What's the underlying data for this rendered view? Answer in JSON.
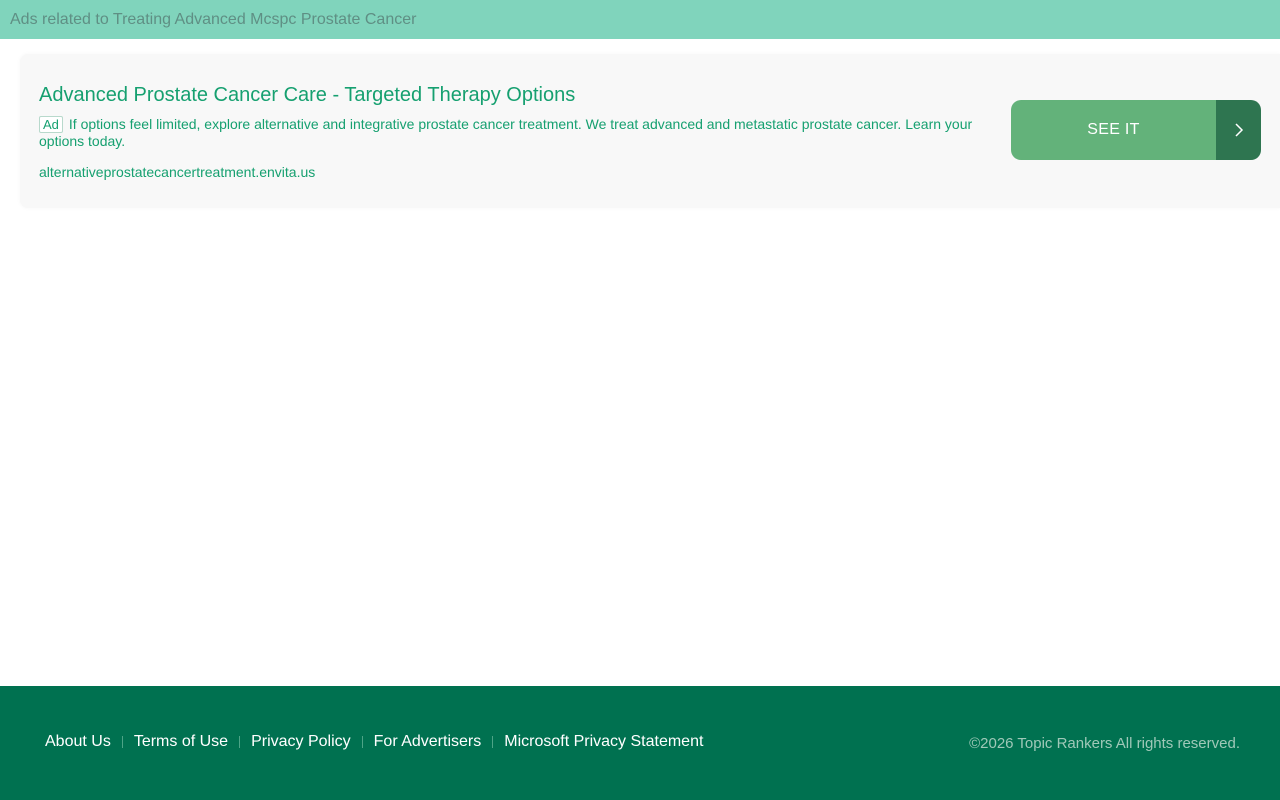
{
  "header": {
    "text": "Ads related to Treating Advanced Mcspc Prostate Cancer"
  },
  "ad": {
    "title": "Advanced Prostate Cancer Care - Targeted Therapy Options",
    "badge": "Ad",
    "description": "If options feel limited, explore alternative and integrative prostate cancer treatment. We treat advanced and metastatic prostate cancer. Learn your options today.",
    "display_url": "alternativeprostatecancertreatment.envita.us",
    "cta_label": "SEE IT",
    "cta_icon": "chevron-right-icon"
  },
  "footer": {
    "links": [
      {
        "label": "About Us"
      },
      {
        "label": "Terms of Use"
      },
      {
        "label": "Privacy Policy"
      },
      {
        "label": "For Advertisers"
      },
      {
        "label": "Microsoft Privacy Statement"
      }
    ],
    "copyright": "©2026 Topic Rankers All rights reserved."
  },
  "colors": {
    "header_bg": "#80d4bc",
    "accent_text": "#16a070",
    "cta_bg": "#63b27a",
    "cta_arrow_bg": "#2e7550",
    "footer_bg": "#007150"
  }
}
